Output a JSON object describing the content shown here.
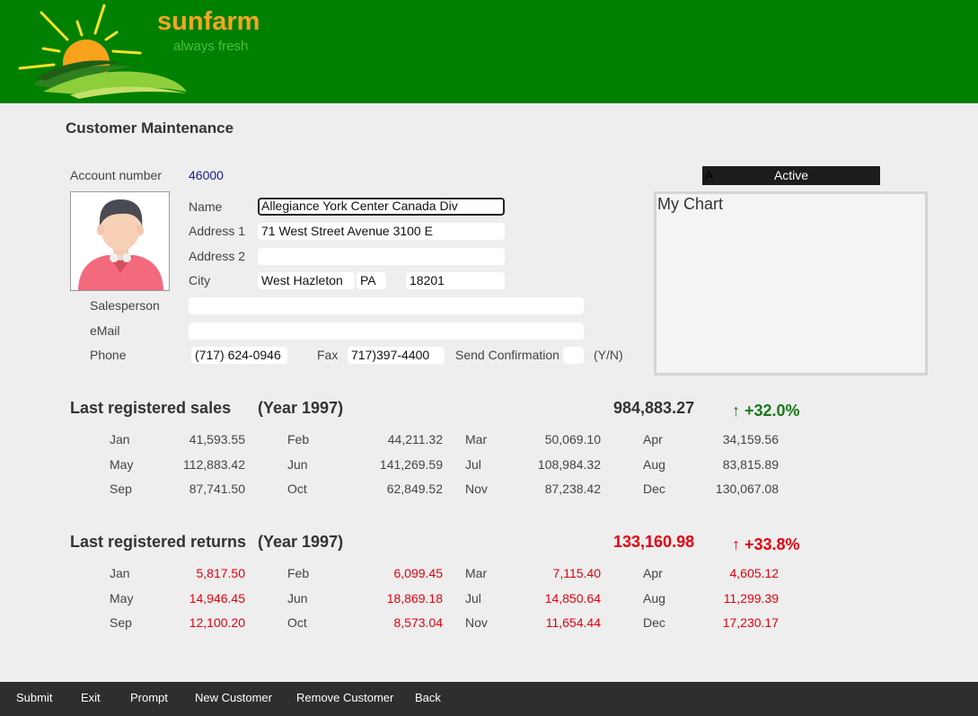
{
  "header": {
    "brand": "sunfarm",
    "tagline": "always fresh",
    "colors": {
      "bar": "#008000",
      "brand": "#f5a623",
      "tagline": "#4cbf3a"
    }
  },
  "page_title": "Customer Maintenance",
  "customer": {
    "account_label": "Account number",
    "account_value": "46000",
    "name_label": "Name",
    "name_value": "Allegiance York Center Canada Div",
    "address1_label": "Address 1",
    "address1_value": "71 West Street Avenue 3100 E",
    "address2_label": "Address 2",
    "address2_value": "",
    "city_label": "City",
    "city_value": "West Hazleton",
    "state_value": "PA",
    "zip_value": "18201",
    "salesperson_label": "Salesperson",
    "salesperson_value": "",
    "email_label": "eMail",
    "email_value": "",
    "phone_label": "Phone",
    "phone_value": "(717) 624-0946",
    "fax_label": "Fax",
    "fax_value": "717)397-4400",
    "confirm_label": "Send Confirmation",
    "confirm_value": "",
    "confirm_hint": "(Y/N)"
  },
  "status": {
    "code": "A",
    "text": "Active"
  },
  "chart": {
    "title": "My Chart"
  },
  "sales": {
    "title": "Last registered sales",
    "year": "(Year 1997)",
    "total": "984,883.27",
    "change": "+32.0%",
    "arrow": "↑",
    "color": "#1a7a1a",
    "months": [
      {
        "m": "Jan",
        "v": "41,593.55"
      },
      {
        "m": "Feb",
        "v": "44,211.32"
      },
      {
        "m": "Mar",
        "v": "50,069.10"
      },
      {
        "m": "Apr",
        "v": "34,159.56"
      },
      {
        "m": "May",
        "v": "112,883.42"
      },
      {
        "m": "Jun",
        "v": "141,269.59"
      },
      {
        "m": "Jul",
        "v": "108,984.32"
      },
      {
        "m": "Aug",
        "v": "83,815.89"
      },
      {
        "m": "Sep",
        "v": "87,741.50"
      },
      {
        "m": "Oct",
        "v": "62,849.52"
      },
      {
        "m": "Nov",
        "v": "87,238.42"
      },
      {
        "m": "Dec",
        "v": "130,067.08"
      }
    ]
  },
  "returns": {
    "title": "Last registered returns",
    "year": "(Year 1997)",
    "total": "133,160.98",
    "change": "+33.8%",
    "arrow": "↑",
    "color": "#e3000f",
    "months": [
      {
        "m": "Jan",
        "v": "5,817.50"
      },
      {
        "m": "Feb",
        "v": "6,099.45"
      },
      {
        "m": "Mar",
        "v": "7,115.40"
      },
      {
        "m": "Apr",
        "v": "4,605.12"
      },
      {
        "m": "May",
        "v": "14,946.45"
      },
      {
        "m": "Jun",
        "v": "18,869.18"
      },
      {
        "m": "Jul",
        "v": "14,850.64"
      },
      {
        "m": "Aug",
        "v": "11,299.39"
      },
      {
        "m": "Sep",
        "v": "12,100.20"
      },
      {
        "m": "Oct",
        "v": "8,573.04"
      },
      {
        "m": "Nov",
        "v": "11,654.44"
      },
      {
        "m": "Dec",
        "v": "17,230.17"
      }
    ]
  },
  "footer": {
    "buttons": [
      "Submit",
      "Exit",
      "Prompt",
      "New Customer",
      "Remove Customer",
      "Back"
    ]
  }
}
